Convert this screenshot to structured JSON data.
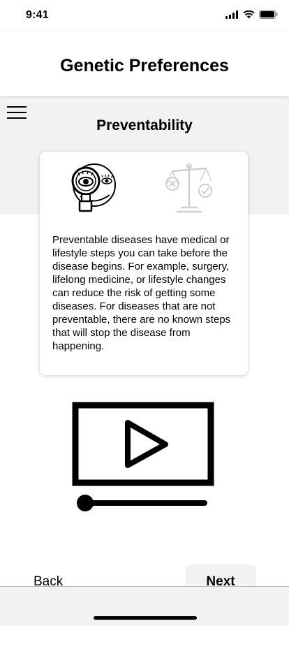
{
  "status": {
    "time": "9:41"
  },
  "header": {
    "title": "Genetic Preferences"
  },
  "section": {
    "title": "Preventability"
  },
  "card": {
    "description": "Preventable diseases have medical or lifestyle steps you can take before the disease begins. For example, surgery, lifelong medicine, or lifestyle changes can reduce the risk of getting some diseases. For diseases that are not preventable, there are no known steps that will stop the disease from happening.",
    "icons": [
      "magnifier-face-icon",
      "scale-icon"
    ]
  },
  "video": {
    "icon": "play-icon",
    "progress": 0
  },
  "nav": {
    "back_label": "Back",
    "next_label": "Next"
  }
}
